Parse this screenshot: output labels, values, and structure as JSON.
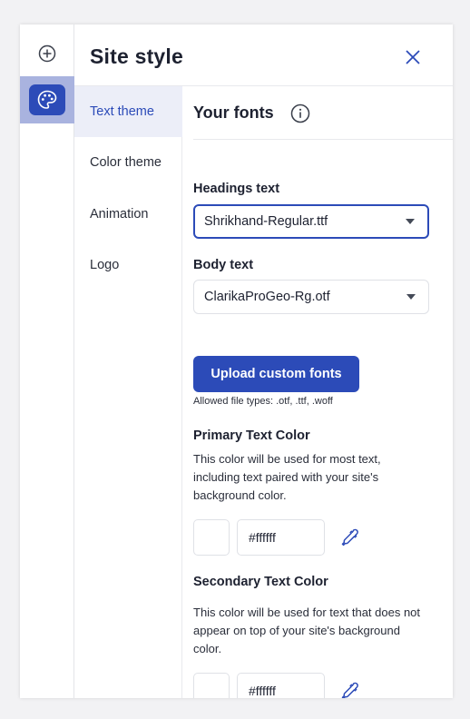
{
  "panel": {
    "title": "Site style"
  },
  "nav": {
    "items": [
      {
        "label": "Text theme",
        "active": true
      },
      {
        "label": "Color theme",
        "active": false
      },
      {
        "label": "Animation",
        "active": false
      },
      {
        "label": "Logo",
        "active": false
      }
    ]
  },
  "fonts": {
    "section_title": "Your fonts",
    "headings": {
      "label": "Headings text",
      "value": "Shrikhand-Regular.ttf"
    },
    "body": {
      "label": "Body text",
      "value": "ClarikaProGeo-Rg.otf"
    },
    "upload_label": "Upload custom fonts",
    "allowed_types": "Allowed file types: .otf, .ttf, .woff"
  },
  "primary_color": {
    "label": "Primary Text Color",
    "description": "This color will be used for most text, including text paired with your site's background color.",
    "value": "#ffffff"
  },
  "secondary_color": {
    "label": "Secondary Text Color",
    "description": "This color will be used for text that does not appear on top of your site's background color.",
    "value": "#ffffff"
  },
  "colors": {
    "accent": "#2c4bb8",
    "accent_light": "#a9b3df",
    "active_nav_bg": "#eceef8"
  },
  "icons": {
    "add": "plus-circle-icon",
    "style": "palette-icon",
    "close": "close-icon",
    "info": "info-icon",
    "picker": "eyedropper-icon"
  }
}
